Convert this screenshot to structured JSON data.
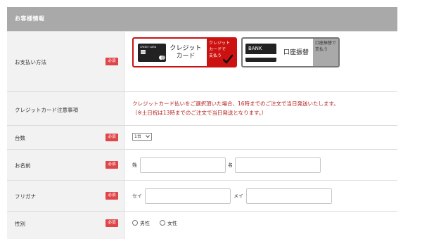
{
  "section": {
    "title": "お客様情報"
  },
  "required_badge": "必須",
  "payment": {
    "label": "お支払い方法",
    "credit": {
      "card_text": "CREDIT CARD",
      "label_line1": "クレジット",
      "label_line2": "カード",
      "side_line1": "クレジット",
      "side_line2": "カードで",
      "side_line3": "支払う"
    },
    "bank": {
      "card_text": "BANK",
      "label": "口座振替",
      "side_line1": "口座振替で",
      "side_line2": "支払う"
    }
  },
  "credit_notice": {
    "label": "クレジットカード注意事項",
    "line1": "クレジットカード払いをご選択頂いた場合、16時までのご注文で当日発送いたします。",
    "line2": "（※土日祝は13時までのご注文で当日発送となります。）"
  },
  "quantity": {
    "label": "台数",
    "value": "1台"
  },
  "name": {
    "label": "お名前",
    "last_label": "姓",
    "first_label": "名"
  },
  "furigana": {
    "label": "フリガナ",
    "last_label": "セイ",
    "first_label": "メイ"
  },
  "gender": {
    "label": "性別",
    "options": [
      "男性",
      "女性"
    ]
  },
  "colors": {
    "header_bg": "#a9a9a9",
    "badge": "#e0454a",
    "accent_red": "#cc1111",
    "label_bg": "#f2f2f2"
  }
}
